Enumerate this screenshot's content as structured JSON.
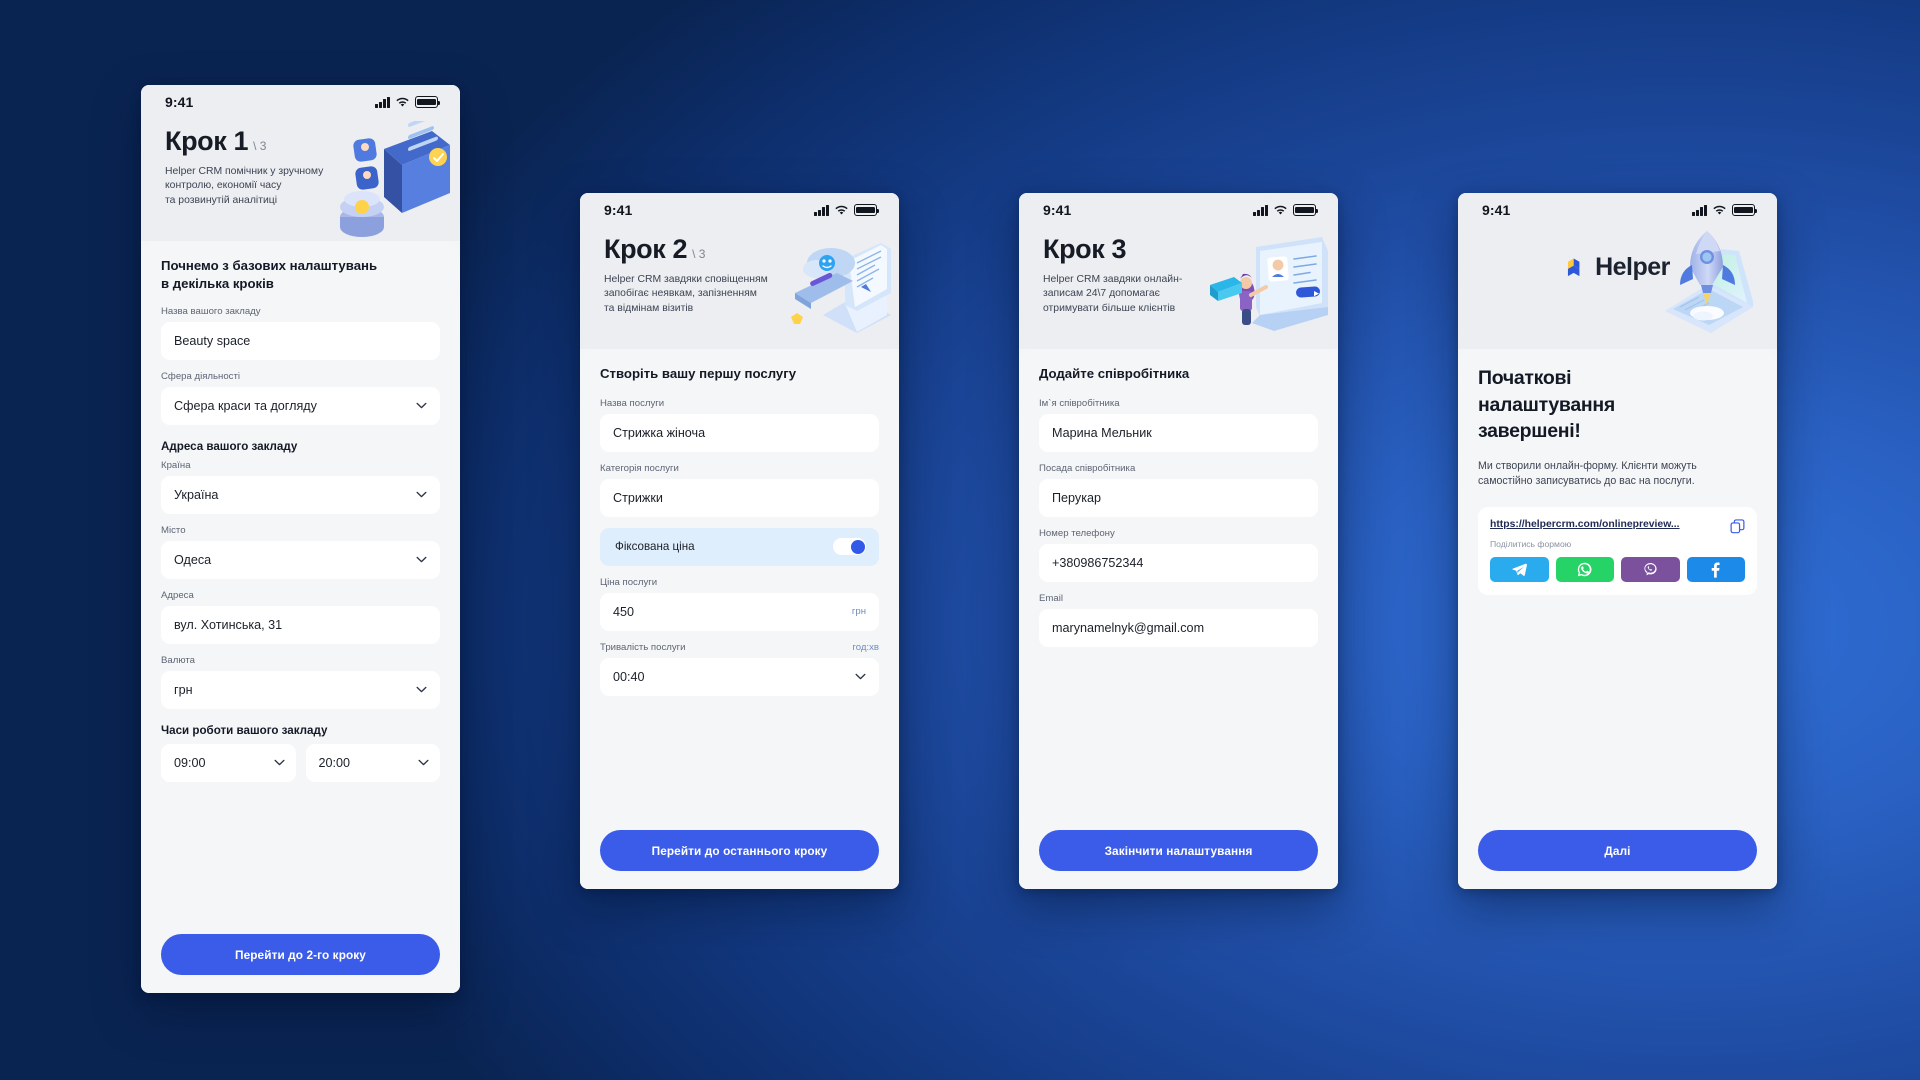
{
  "background": {
    "accent": "#3a5ce8",
    "deep": "#0a1c3d",
    "mid": "#2a6ad0"
  },
  "status": {
    "time": "9:41",
    "signal_icon": "cellular-signal-icon",
    "wifi_icon": "wifi-icon",
    "battery_icon": "battery-icon"
  },
  "screens": [
    {
      "id": "step1",
      "hero": {
        "title": "Крок 1",
        "counter": "\\ 3",
        "subtitle": "Helper CRM помічник у зручному\nконтролю, економії часу\nта розвинутій аналітиці",
        "art": "dashboard-analytics-illustration"
      },
      "sheet_title": "Почнемо з базових налаштувань\nв декілька кроків",
      "fields": [
        {
          "name": "venue-name",
          "label": "Назва вашого закладу",
          "value": "Beauty space",
          "type": "text"
        },
        {
          "name": "business-sphere",
          "label": "Сфера діяльності",
          "value": "Сфера краси та догляду",
          "type": "select"
        }
      ],
      "group_label": "Адреса вашого закладу",
      "address_fields": [
        {
          "name": "country",
          "label": "Країна",
          "value": "Україна",
          "type": "select"
        },
        {
          "name": "city",
          "label": "Місто",
          "value": "Одеса",
          "type": "select"
        },
        {
          "name": "street",
          "label": "Адреса",
          "value": "вул. Хотинська, 31",
          "type": "text"
        },
        {
          "name": "currency",
          "label": "Валюта",
          "value": "грн",
          "type": "select"
        }
      ],
      "hours_label": "Часи роботи вашого закладу",
      "hours": {
        "from": "09:00",
        "to": "20:00"
      },
      "cta": "Перейти до 2-го кроку"
    },
    {
      "id": "step2",
      "hero": {
        "title": "Крок 2",
        "counter": "\\ 3",
        "subtitle": "Helper CRM завдяки сповіщенням\nзапобігає неявкам, запізненням\nта відмінам візитів",
        "art": "laptop-notification-illustration"
      },
      "sheet_title": "Створіть вашу першу послугу",
      "fields": [
        {
          "name": "service-name",
          "label": "Назва послуги",
          "value": "Стрижка жіноча",
          "type": "text"
        },
        {
          "name": "service-category",
          "label": "Категорія послуги",
          "value": "Стрижки",
          "type": "text"
        }
      ],
      "toggle": {
        "label": "Фіксована ціна",
        "on": true
      },
      "price": {
        "name": "service-price",
        "label": "Ціна послуги",
        "value": "450",
        "suffix": "грн"
      },
      "duration": {
        "name": "service-duration",
        "label": "Тривалість послуги",
        "unit": "год:хв",
        "value": "00:40"
      },
      "cta": "Перейти до останнього кроку"
    },
    {
      "id": "step3",
      "hero": {
        "title": "Крок 3",
        "counter": "",
        "subtitle": "Helper CRM завдяки онлайн-\nзаписам 24\\7 допомагає\nотримувати більше клієнтів",
        "art": "online-booking-illustration"
      },
      "sheet_title": "Додайте співробітника",
      "fields": [
        {
          "name": "employee-name",
          "label": "Ім`я співробітника",
          "value": "Марина Мельник",
          "type": "text"
        },
        {
          "name": "employee-position",
          "label": "Посада співробітника",
          "value": "Перукар",
          "type": "text"
        },
        {
          "name": "employee-phone",
          "label": "Номер телефону",
          "value": "+380986752344",
          "type": "text"
        },
        {
          "name": "employee-email",
          "label": "Email",
          "value": "marynamelnyk@gmail.com",
          "type": "text"
        }
      ],
      "cta": "Закінчити налаштування"
    },
    {
      "id": "done",
      "logo": {
        "word": "Helper",
        "mark": "helper-logo-icon",
        "art": "rocket-laptop-illustration"
      },
      "title": "Початкові\nналаштування\nзавершені!",
      "body": "Ми створили онлайн-форму. Клієнти можуть\nсамостійно записуватись до вас на послуги.",
      "link": "https://helpercrm.com/onlinepreview...",
      "copy_icon": "copy-icon",
      "share_hint": "Поділитись формою",
      "share": [
        {
          "name": "telegram",
          "color": "#2aabee",
          "icon": "telegram-icon"
        },
        {
          "name": "whatsapp",
          "color": "#25d366",
          "icon": "whatsapp-icon"
        },
        {
          "name": "viber",
          "color": "#7b519d",
          "icon": "viber-icon"
        },
        {
          "name": "facebook",
          "color": "#1b8ae8",
          "icon": "facebook-icon"
        }
      ],
      "cta": "Далі"
    }
  ]
}
